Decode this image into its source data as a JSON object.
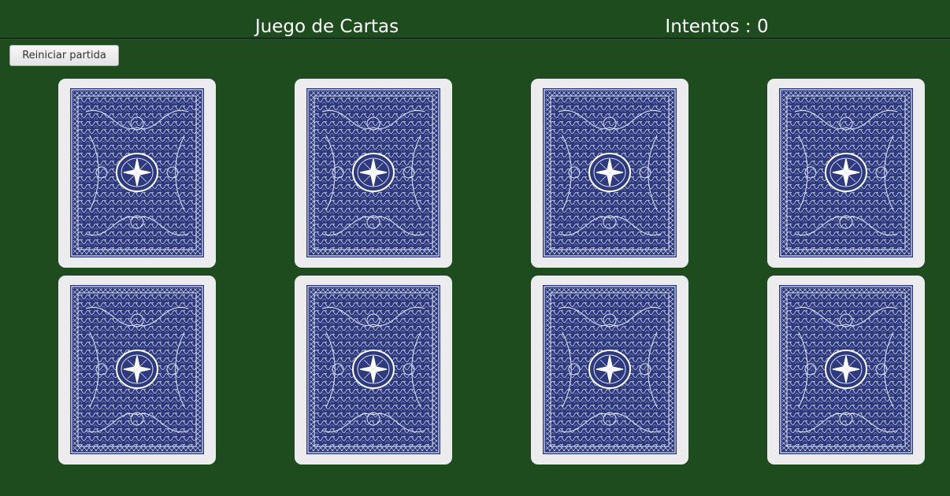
{
  "header": {
    "title": "Juego de Cartas",
    "attempts_label": "Intentos : 0"
  },
  "controls": {
    "reset_label": "Reiniciar partida"
  },
  "board": {
    "face_down_cards": 8,
    "card_back_color": "#2e3a7d",
    "card_edge_color": "#ececee",
    "table_color": "#1e4c1f"
  }
}
